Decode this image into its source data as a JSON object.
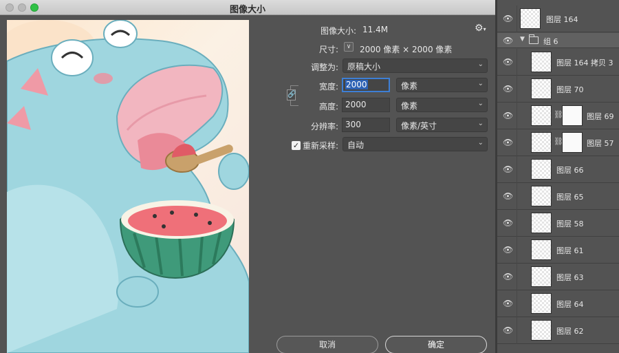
{
  "window": {
    "title": "图像大小"
  },
  "form": {
    "image_size_label": "图像大小:",
    "image_size_value": "11.4M",
    "dimensions_label": "尺寸:",
    "dimensions_value": "2000 像素  ×  2000 像素",
    "fit_label": "调整为:",
    "fit_value": "原稿大小",
    "width_label": "宽度:",
    "width_value": "2000",
    "width_unit": "像素",
    "height_label": "高度:",
    "height_value": "2000",
    "height_unit": "像素",
    "resolution_label": "分辨率:",
    "resolution_value": "300",
    "resolution_unit": "像素/英寸",
    "resample_label": "重新采样:",
    "resample_checked": true,
    "resample_value": "自动"
  },
  "buttons": {
    "cancel": "取消",
    "ok": "确定"
  },
  "layers": {
    "top": "图层 164",
    "group": "组 6",
    "items": [
      {
        "name": "图层 164 拷贝 3"
      },
      {
        "name": "图层 70"
      },
      {
        "name": "图层 69",
        "has_mask": true
      },
      {
        "name": "图层 57",
        "has_mask": true
      },
      {
        "name": "图层 66"
      },
      {
        "name": "图层 65"
      },
      {
        "name": "图层 58"
      },
      {
        "name": "图层 61"
      },
      {
        "name": "图层 63"
      },
      {
        "name": "图层 64"
      },
      {
        "name": "图层 62"
      }
    ]
  },
  "colors": {
    "accent": "#3d7fd6",
    "zoom_button": "#2fc145"
  }
}
